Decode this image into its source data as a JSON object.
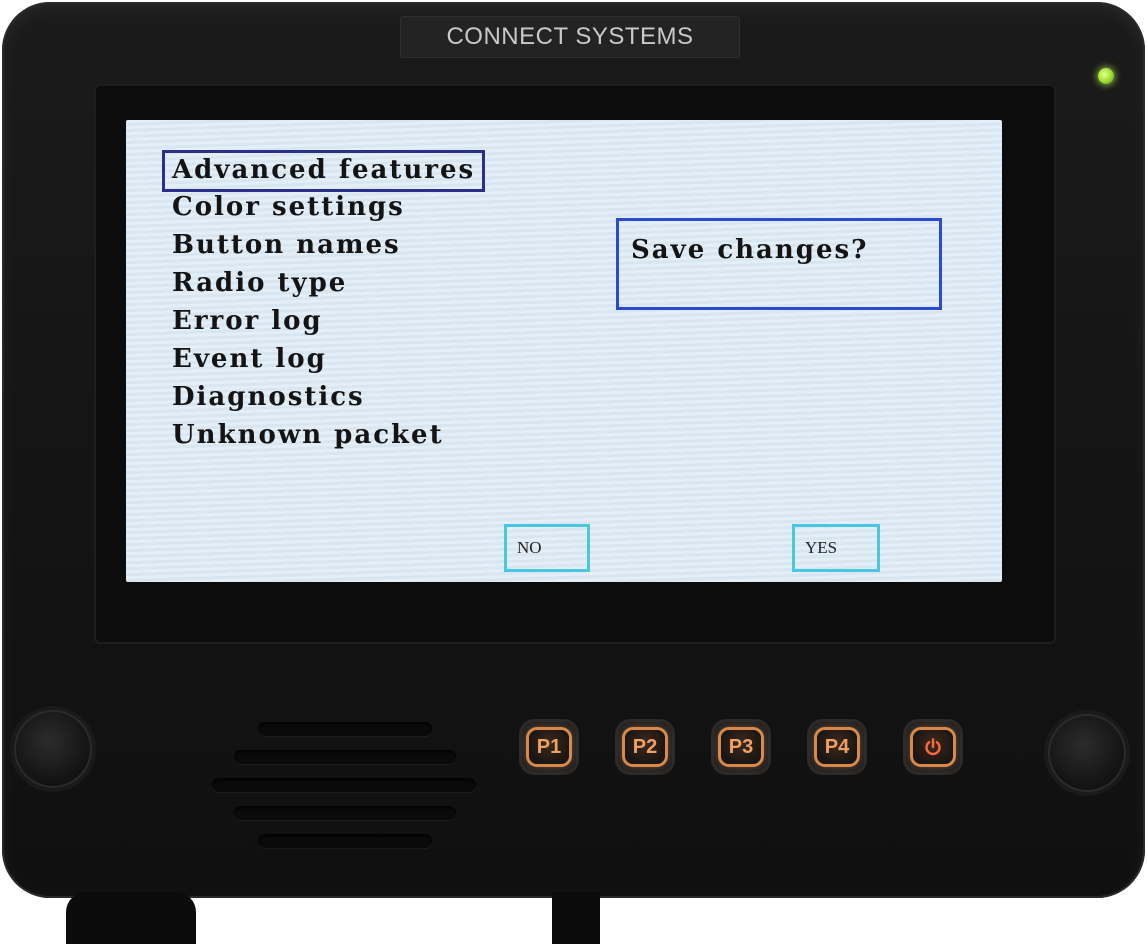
{
  "device": {
    "brand": "CONNECT SYSTEMS"
  },
  "screen": {
    "menu": {
      "items": [
        {
          "label": "Advanced features",
          "selected": true
        },
        {
          "label": "Color settings"
        },
        {
          "label": "Button names"
        },
        {
          "label": "Radio type"
        },
        {
          "label": "Error log"
        },
        {
          "label": "Event log"
        },
        {
          "label": "Diagnostics"
        },
        {
          "label": "Unknown packet"
        }
      ]
    },
    "dialog": {
      "message": "Save changes?",
      "no_label": "NO",
      "yes_label": "YES"
    }
  },
  "hardware_keys": [
    {
      "label": "P1"
    },
    {
      "label": "P2"
    },
    {
      "label": "P3"
    },
    {
      "label": "P4"
    },
    {
      "icon": "power-icon"
    }
  ],
  "colors": {
    "screen_bg": "#dfeaf4",
    "selection_border": "#2c2f8a",
    "dialog_border": "#2a4bd0",
    "button_border": "#4ac6e0",
    "key_glow": "#d88a4a",
    "led": "#a8e63a"
  }
}
